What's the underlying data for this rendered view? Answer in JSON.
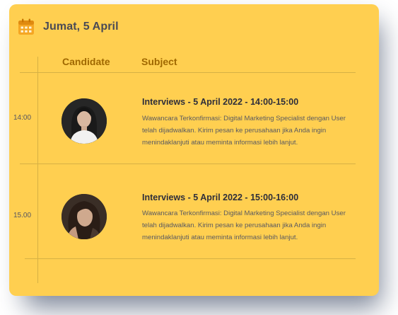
{
  "header": {
    "date": "Jumat, 5 April",
    "icon": "calendar-icon"
  },
  "columns": {
    "candidate": "Candidate",
    "subject": "Subject"
  },
  "schedule": [
    {
      "time": "14:00",
      "title": "Interviews - 5 April 2022 - 14:00-15:00",
      "description": "Wawancara Terkonfirmasi: Digital Marketing Specialist dengan User telah dijadwalkan. Kirim pesan ke perusahaan jika Anda ingin menindaklanjuti atau meminta informasi lebih lanjut."
    },
    {
      "time": "15.00",
      "title": "Interviews - 5 April 2022 - 15:00-16:00",
      "description": "Wawancara Terkonfirmasi: Digital Marketing Specialist dengan User telah dijadwalkan. Kirim pesan ke perusahaan jika Anda ingin menindaklanjuti atau meminta informasi lebih lanjut."
    }
  ],
  "colors": {
    "card": "#FFCF50",
    "accent": "#a06800",
    "icon": "#F5A623"
  }
}
